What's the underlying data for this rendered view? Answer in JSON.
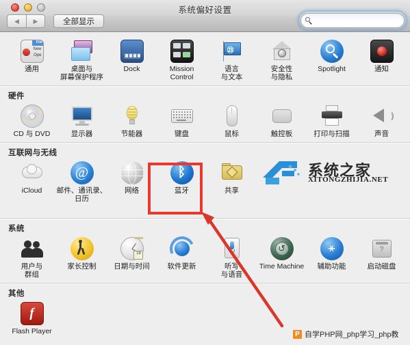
{
  "window": {
    "title": "系统偏好设置",
    "traffic_lights": [
      "close",
      "minimize",
      "zoom"
    ],
    "back_label": "◀",
    "forward_label": "▶",
    "show_all_label": "全部显示"
  },
  "search": {
    "placeholder": "",
    "value": "",
    "icon": "search-icon"
  },
  "sections": [
    {
      "id": "personal",
      "header": "",
      "items": [
        {
          "id": "general",
          "label": "通用",
          "icon": "general-icon"
        },
        {
          "id": "desktop",
          "label": "桌面与\n屏幕保护程序",
          "icon": "desktop-screensaver-icon"
        },
        {
          "id": "dock",
          "label": "Dock",
          "icon": "dock-icon"
        },
        {
          "id": "mission",
          "label": "Mission\nControl",
          "icon": "mission-control-icon"
        },
        {
          "id": "language",
          "label": "语言\n与文本",
          "icon": "language-text-icon"
        },
        {
          "id": "security",
          "label": "安全性\n与隐私",
          "icon": "security-privacy-icon"
        },
        {
          "id": "spotlight",
          "label": "Spotlight",
          "icon": "spotlight-icon"
        },
        {
          "id": "notify",
          "label": "通知",
          "icon": "notifications-icon"
        }
      ]
    },
    {
      "id": "hardware",
      "header": "硬件",
      "items": [
        {
          "id": "cddvd",
          "label": "CD 与 DVD",
          "icon": "cd-dvd-icon"
        },
        {
          "id": "displays",
          "label": "显示器",
          "icon": "displays-icon"
        },
        {
          "id": "energy",
          "label": "节能器",
          "icon": "energy-saver-icon"
        },
        {
          "id": "keyboard",
          "label": "键盘",
          "icon": "keyboard-icon"
        },
        {
          "id": "mouse",
          "label": "鼠标",
          "icon": "mouse-icon"
        },
        {
          "id": "trackpad",
          "label": "触控板",
          "icon": "trackpad-icon"
        },
        {
          "id": "print",
          "label": "打印与扫描",
          "icon": "print-scan-icon"
        },
        {
          "id": "sound",
          "label": "声音",
          "icon": "sound-icon"
        }
      ]
    },
    {
      "id": "internet",
      "header": "互联网与无线",
      "items": [
        {
          "id": "icloud",
          "label": "iCloud",
          "icon": "icloud-icon"
        },
        {
          "id": "mail",
          "label": "邮件、通讯录、\n日历",
          "icon": "mail-contacts-calendars-icon"
        },
        {
          "id": "network",
          "label": "网络",
          "icon": "network-icon"
        },
        {
          "id": "bluetooth",
          "label": "蓝牙",
          "icon": "bluetooth-icon",
          "highlighted": true
        },
        {
          "id": "sharing",
          "label": "共享",
          "icon": "sharing-icon"
        }
      ]
    },
    {
      "id": "system",
      "header": "系统",
      "items": [
        {
          "id": "users",
          "label": "用户与\n群组",
          "icon": "users-groups-icon"
        },
        {
          "id": "parental",
          "label": "家长控制",
          "icon": "parental-controls-icon"
        },
        {
          "id": "datetime",
          "label": "日期与时间",
          "icon": "date-time-icon"
        },
        {
          "id": "update",
          "label": "软件更新",
          "icon": "software-update-icon"
        },
        {
          "id": "dictate",
          "label": "听写\n与语音",
          "icon": "dictation-speech-icon"
        },
        {
          "id": "timemac",
          "label": "Time Machine",
          "icon": "time-machine-icon"
        },
        {
          "id": "access",
          "label": "辅助功能",
          "icon": "accessibility-icon"
        },
        {
          "id": "startup",
          "label": "启动磁盘",
          "icon": "startup-disk-icon"
        }
      ]
    },
    {
      "id": "other",
      "header": "其他",
      "items": [
        {
          "id": "flash",
          "label": "Flash Player",
          "icon": "flash-player-icon"
        }
      ]
    }
  ],
  "annotations": {
    "highlight_color": "#e8392c",
    "highlight_target": "蓝牙",
    "arrow_color": "#d9372a"
  },
  "watermarks": {
    "center": {
      "title": "系统之家",
      "url": "XITONGZHIJIA.NET",
      "color": "#2b8fd6"
    },
    "bottom": {
      "badge": "P",
      "text": "自学PHP网_php学习_php教",
      "badge_color": "#f08a24"
    }
  }
}
